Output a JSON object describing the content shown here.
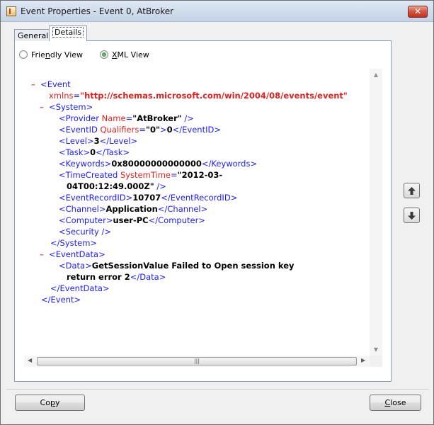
{
  "window": {
    "title": "Event Properties - Event 0, AtBroker",
    "close_glyph": "✕"
  },
  "tabs": [
    {
      "label": "General"
    },
    {
      "label": "Details"
    }
  ],
  "view_options": {
    "friendly": {
      "pre": "Frie",
      "accel": "n",
      "post": "dly View"
    },
    "xml": {
      "accel": "X",
      "post": "ML View"
    },
    "selected": "xml"
  },
  "xml": {
    "collapse_glyph": "–",
    "event_tag": "Event",
    "xmlns_attr": "xmlns",
    "xmlns_value": "\"http://schemas.microsoft.com/win/2004/08/events/event\"",
    "system_tag": "System",
    "provider_tag": "Provider",
    "provider_attr": "Name",
    "provider_value": "\"AtBroker\"",
    "eventid_tag": "EventID",
    "eventid_attr": "Qualifiers",
    "eventid_attr_value": "\"0\"",
    "eventid_value": "0",
    "level_tag": "Level",
    "level_value": "3",
    "task_tag": "Task",
    "task_value": "0",
    "keywords_tag": "Keywords",
    "keywords_value": "0x80000000000000",
    "timecreated_tag": "TimeCreated",
    "timecreated_attr": "SystemTime",
    "timecreated_value_line1": "\"2012-03-",
    "timecreated_value_line2": "04T00:12:49.000Z\"",
    "recordid_tag": "EventRecordID",
    "recordid_value": "10707",
    "channel_tag": "Channel",
    "channel_value": "Application",
    "computer_tag": "Computer",
    "computer_value": "user-PC",
    "security_tag": "Security",
    "eventdata_tag": "EventData",
    "data_tag": "Data",
    "data_value_line1": "GetSessionValue Failed to Open session key",
    "data_value_line2": "return error 2"
  },
  "buttons": {
    "copy": {
      "pre": "Co",
      "accel": "p",
      "post": "y"
    },
    "close": {
      "accel": "C",
      "post": "lose"
    }
  }
}
